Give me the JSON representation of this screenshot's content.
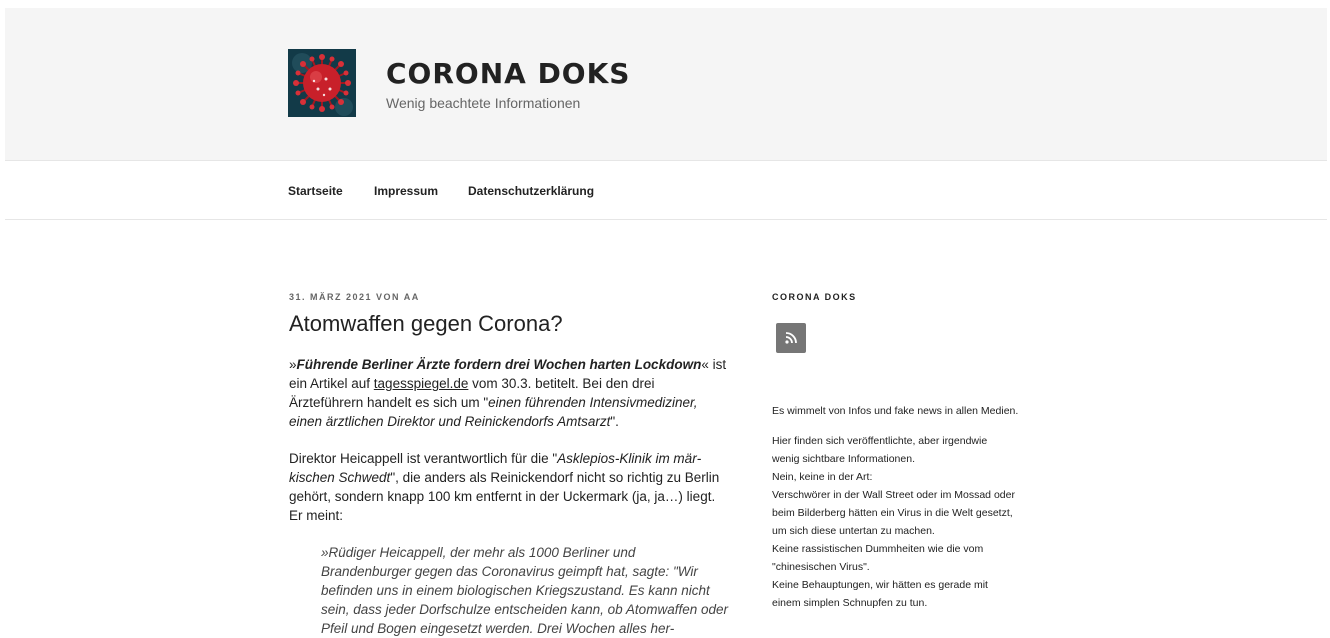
{
  "site": {
    "title": "CORONA DOKS",
    "description": "Wenig beachtete Informationen",
    "logo_icon": "coronavirus-icon"
  },
  "nav": {
    "items": [
      {
        "label": "Startseite"
      },
      {
        "label": "Impressum"
      },
      {
        "label": "Datenschutzerklärung"
      }
    ]
  },
  "post": {
    "meta": "31. März 2021 von aa",
    "title": "Atomwaffen gegen Corona?",
    "p1": {
      "lead_open": "»",
      "lead_bold": "Führende Berliner Ärzte fordern drei Wochen harten Lockdown",
      "lead_close": "« ist ein Artikel auf ",
      "link": "tagesspiegel.de",
      "after_link": " vom 30.3. betitelt. Bei den drei Ärzteführern handelt es sich um \"",
      "quote": "einen führenden Intensivmediziner, einen ärztlichen Direktor und Reinickendorfs Amtsarzt",
      "end": "\"."
    },
    "p2": {
      "start": "Direktor Heicappell ist verantwortlich für die \"",
      "quote": "Asklepios-Klinik im mär­kischen Schwedt",
      "rest": "\", die anders als Reinickendorf nicht so richtig zu Berlin gehört, sondern knapp 100 km entfernt in der Uckermark (ja, ja…) liegt. Er meint:"
    },
    "blockquote": "»Rüdiger Heicappell, der mehr als 1000 Berliner und Brandenburger gegen das Coronavirus geimpft hat, sagte: \"Wir befinden uns in einem biologischen Kriegszustand. Es kann nicht sein, dass jeder Dorfschulze entscheiden kann, ob Atomwaffen oder Pfeil und Bogen eingesetzt werden. Drei Wochen alles her-"
  },
  "sidebar": {
    "title": "CORONA DOKS",
    "rss_icon": "rss-icon",
    "p1": "Es wimmelt von Infos und fake news in allen Medien.",
    "lines": [
      "Hier finden sich veröffentlichte, aber irgendwie",
      "wenig sichtbare Informationen.",
      "Nein, keine in der Art:",
      "Verschwörer in der Wall Street oder im Mossad oder",
      "beim Bilderberg hätten ein Virus in die Welt gesetzt,",
      "um sich diese untertan zu machen.",
      "Keine rassistischen Dummheiten wie die vom",
      "\"chinesischen Virus\".",
      "Keine Behauptungen, wir hätten es gerade mit",
      "einem simplen Schnupfen zu tun."
    ]
  },
  "colors": {
    "header_bg": "#f5f5f5",
    "virus_red": "#c8202a",
    "logo_bg": "#123a48",
    "rss_bg": "#767676"
  }
}
